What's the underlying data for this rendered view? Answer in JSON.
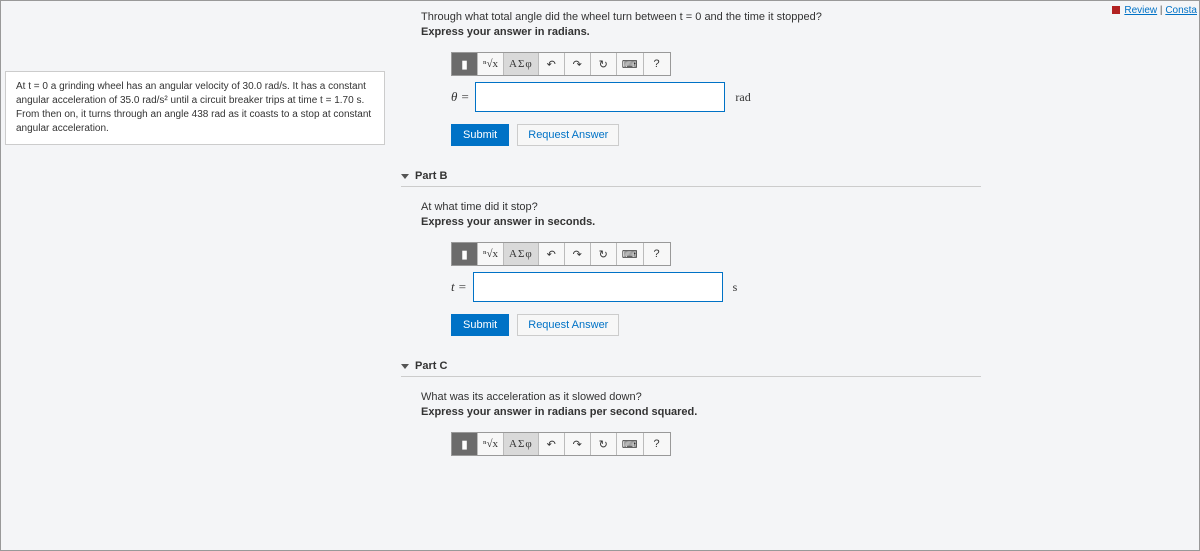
{
  "topnav": {
    "review": "Review",
    "constants": "Consta"
  },
  "problem": {
    "text": "At t = 0 a grinding wheel has an angular velocity of 30.0 rad/s. It has a constant angular acceleration of 35.0 rad/s² until a circuit breaker trips at time t = 1.70 s. From then on, it turns through an angle 438 rad as it coasts to a stop at constant angular acceleration."
  },
  "partA": {
    "question": "Through what total angle did the wheel turn between t = 0 and the time it stopped?",
    "instruction": "Express your answer in radians.",
    "varlabel": "θ =",
    "unit": "rad",
    "submit": "Submit",
    "request": "Request Answer"
  },
  "partB": {
    "header": "Part B",
    "question": "At what time did it stop?",
    "instruction": "Express your answer in seconds.",
    "varlabel": "t =",
    "unit": "s",
    "submit": "Submit",
    "request": "Request Answer"
  },
  "partC": {
    "header": "Part C",
    "question": "What was its acceleration as it slowed down?",
    "instruction": "Express your answer in radians per second squared."
  },
  "toolbar": {
    "templates": "▮",
    "sqrt": "ⁿ√x",
    "greek": "ΑΣφ",
    "undo": "↶",
    "redo": "↷",
    "reset": "↻",
    "keyboard": "⌨",
    "help": "?"
  }
}
